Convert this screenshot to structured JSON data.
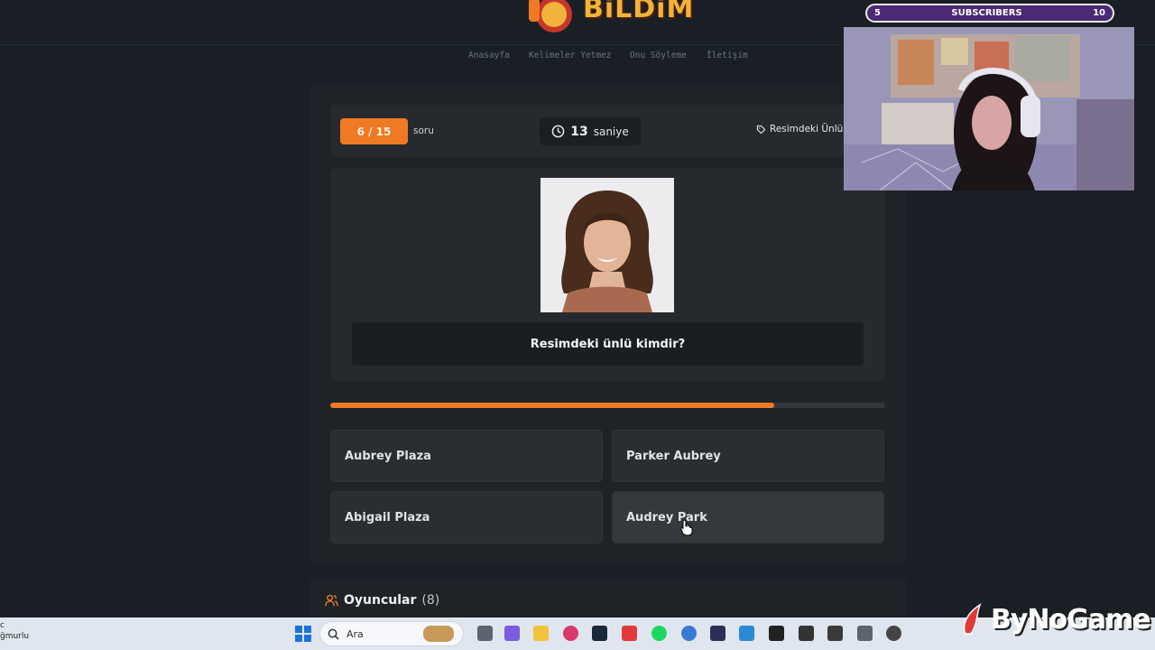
{
  "header": {
    "logo_text": "BiLDiM",
    "nav": [
      "Anasayfa",
      "Kelimeler Yetmez",
      "Onu Söyleme",
      "İletişim"
    ]
  },
  "quiz": {
    "counter": "6 / 15",
    "counter_suffix": "soru",
    "timer_value": "13",
    "timer_unit": "saniye",
    "category": "Resimdeki Ünlü",
    "question": "Resimdeki ünlü kimdir?",
    "progress_fraction": 0.8,
    "answers": [
      "Aubrey Plaza",
      "Parker Aubrey",
      "Abigail Plaza",
      "Audrey Park"
    ]
  },
  "players": {
    "title": "Oyuncular",
    "count": "(8)"
  },
  "overlay": {
    "subscribers_label": "SUBSCRIBERS",
    "subscribers_current": "5",
    "subscribers_goal": "10",
    "brand": "ByNoGame"
  },
  "taskbar": {
    "left_line1": "c",
    "left_line2": "ğmurlu",
    "search_placeholder": "Ara"
  },
  "colors": {
    "accent": "#f07a24",
    "background": "#1a1f26",
    "card": "#1f2226"
  }
}
